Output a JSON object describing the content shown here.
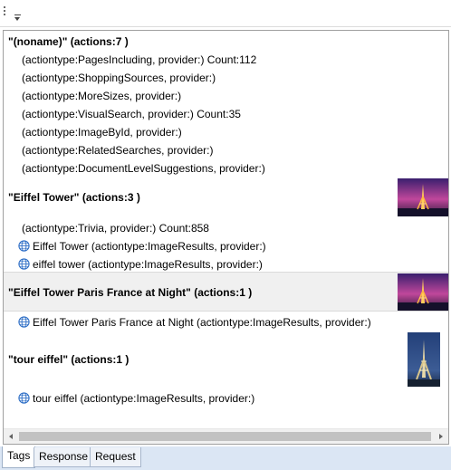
{
  "groups": [
    {
      "title": "\"(noname)\" (actions:7 )",
      "items": [
        {
          "icon": false,
          "text": "(actiontype:PagesIncluding, provider:) Count:112"
        },
        {
          "icon": false,
          "text": "(actiontype:ShoppingSources, provider:)"
        },
        {
          "icon": false,
          "text": "(actiontype:MoreSizes, provider:)"
        },
        {
          "icon": false,
          "text": "(actiontype:VisualSearch, provider:) Count:35"
        },
        {
          "icon": false,
          "text": "(actiontype:ImageById, provider:)"
        },
        {
          "icon": false,
          "text": "(actiontype:RelatedSearches, provider:)"
        },
        {
          "icon": false,
          "text": "(actiontype:DocumentLevelSuggestions, provider:)"
        }
      ]
    },
    {
      "title": "\"Eiffel Tower\" (actions:3 )",
      "items": [
        {
          "icon": false,
          "text": "(actiontype:Trivia, provider:) Count:858"
        },
        {
          "icon": true,
          "text": "Eiffel Tower (actiontype:ImageResults, provider:)"
        },
        {
          "icon": true,
          "text": "eiffel tower (actiontype:ImageResults, provider:)"
        }
      ]
    },
    {
      "title": "\"Eiffel Tower Paris France at Night\" (actions:1 )",
      "items": [
        {
          "icon": true,
          "text": "Eiffel Tower Paris France at Night (actiontype:ImageResults, provider:)"
        }
      ]
    },
    {
      "title": "\"tour eiffel\" (actions:1 )",
      "items": [
        {
          "icon": true,
          "text": "tour eiffel (actiontype:ImageResults, provider:)"
        }
      ]
    }
  ],
  "tabs": [
    "Tags",
    "Response",
    "Request"
  ],
  "active_tab": "Tags",
  "colors": {
    "panel_border": "#a0a0a0",
    "tabstrip_bg": "#dbe6f4",
    "selected_row_bg": "#f0f0f0",
    "globe_blue": "#2f6fc6"
  }
}
